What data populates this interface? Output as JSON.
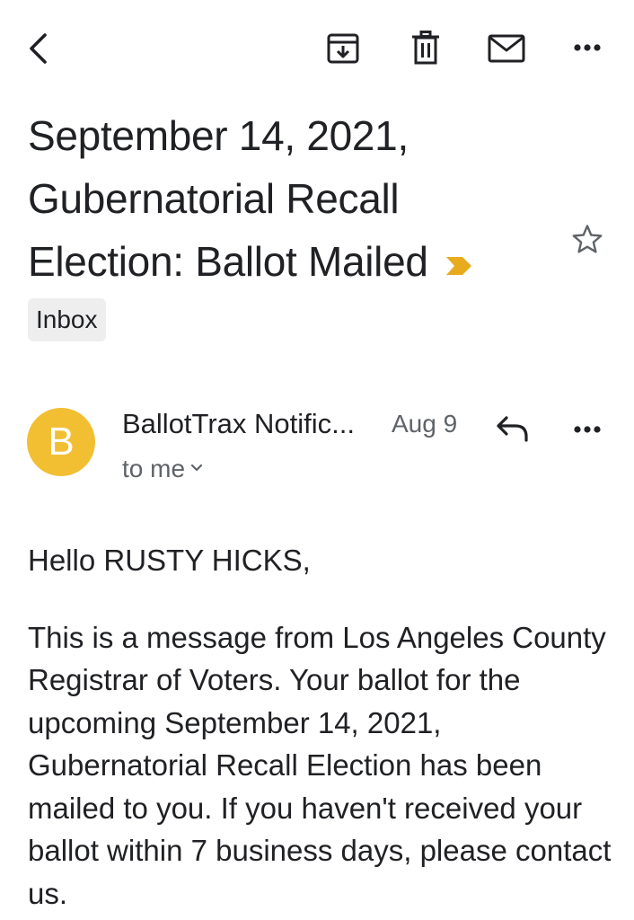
{
  "toolbar": {
    "icons": [
      "back-arrow-icon",
      "archive-icon",
      "trash-icon",
      "mail-icon",
      "more-horiz-icon"
    ]
  },
  "email": {
    "subject": "September 14, 2021, Gubernatorial Recall Election: Ballot Mailed",
    "label": "Inbox",
    "importance_color": "#e8ab1e",
    "starred": false
  },
  "message": {
    "avatar_letter": "B",
    "avatar_color": "#f2bf33",
    "sender": "BallotTrax Notific...",
    "date": "Aug 9",
    "recipient": "to me",
    "greeting": "Hello RUSTY HICKS,",
    "body": "This is a message from Los Angeles County Registrar of Voters. Your ballot for the upcoming September 14, 2021, Gubernatorial Recall Election has been mailed to you. If you haven't received your ballot within 7 business days, please contact us."
  }
}
